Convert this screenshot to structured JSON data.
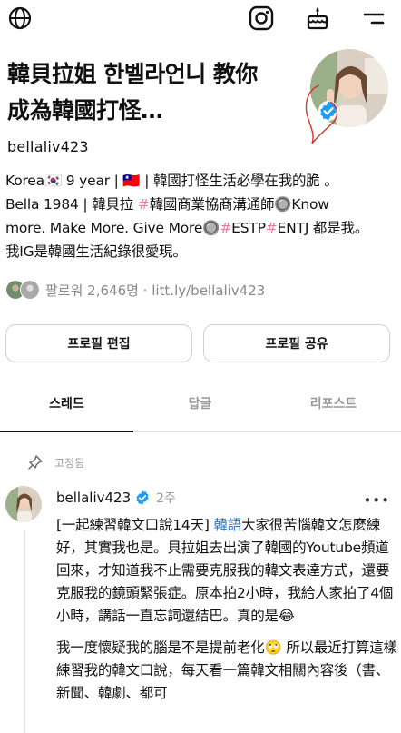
{
  "topbar": {
    "icons": [
      "globe-icon",
      "instagram-icon",
      "cake-icon",
      "menu-icon"
    ]
  },
  "profile": {
    "name_line1": "韓貝拉姐 한벨라언니 教你",
    "name_line2": "成為韓國打怪…",
    "username": "bellaliv423",
    "bio_line1": "Korea🇰🇷 9 year | 🇹🇼 | 韓國打怪生活必學在我的脆 。",
    "bio_line2_a": "Bella 1984 | 韓貝拉 ",
    "bio_tag1": "#",
    "bio_line2_b": "韓國商業協商溝通師🔘Know",
    "bio_line3_a": "more. Make More. Give More🔘",
    "bio_tag2": "#",
    "bio_line3_b": "ESTP",
    "bio_tag3": "#",
    "bio_line3_c": "ENTJ 都是我。",
    "bio_line4": "我IG是韓國生活紀錄很愛現。",
    "followers_text": "팔로워 2,646명 · litt.ly/bellaliv423"
  },
  "buttons": {
    "edit_profile": "프로필 편집",
    "share_profile": "프로필 공유"
  },
  "tabs": {
    "threads": "스레드",
    "replies": "답글",
    "reposts": "리포스트"
  },
  "pinned": {
    "label": "고정됨"
  },
  "post": {
    "username": "bellaliv423",
    "time": "2주",
    "more": "•••",
    "p1_a": "[一起練習韓文口說14天] ",
    "p1_link": "韓語",
    "p1_b": "大家很苦惱韓文怎麼練好，其實我也是。貝拉姐去出演了韓國的Youtube頻道回來，才知道我不止需要克服我的韓文表達方式，還要克服我的鏡頭緊張症。原本拍2小時，我給人家拍了4個小時，講話一直忘詞還結巴。真的是😂",
    "p2": "我一度懷疑我的腦是不是提前老化🙄 所以最近打算這樣練習我的韓文口說，每天看一篇韓文相關內容後（書、新聞、韓劇、都可"
  },
  "colors": {
    "accent_link": "#2a7bd4",
    "hashtag": "#e27fa0",
    "verified": "#1d9bf0"
  }
}
